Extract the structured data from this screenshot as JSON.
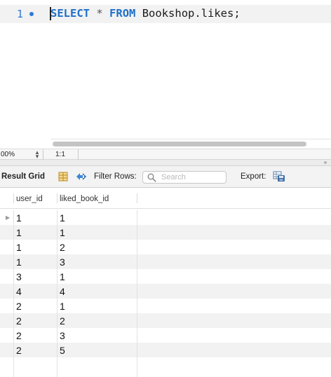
{
  "editor": {
    "line_number": "1",
    "query": {
      "select_kw": "SELECT",
      "star": "*",
      "from_kw": "FROM",
      "rest": "Bookshop.likes;"
    }
  },
  "status_bar": {
    "zoom": "00%",
    "cursor_position": "1:1"
  },
  "result_toolbar": {
    "result_grid_label": "Result Grid",
    "grid_icon": "grid-icon",
    "refresh_icon": "refresh-icon",
    "filter_rows_label": "Filter Rows:",
    "search_placeholder": "Search",
    "search_value": "",
    "export_label": "Export:",
    "export_icon": "export-icon"
  },
  "result_grid": {
    "columns": [
      "user_id",
      "liked_book_id"
    ],
    "rows": [
      [
        "1",
        "1"
      ],
      [
        "1",
        "1"
      ],
      [
        "1",
        "2"
      ],
      [
        "1",
        "3"
      ],
      [
        "3",
        "1"
      ],
      [
        "4",
        "4"
      ],
      [
        "2",
        "1"
      ],
      [
        "2",
        "2"
      ],
      [
        "2",
        "3"
      ],
      [
        "2",
        "5"
      ]
    ]
  },
  "colors": {
    "keyword": "#1f6fc9",
    "line_number": "#2f7ad6",
    "row_alt": "#f2f2f2"
  }
}
